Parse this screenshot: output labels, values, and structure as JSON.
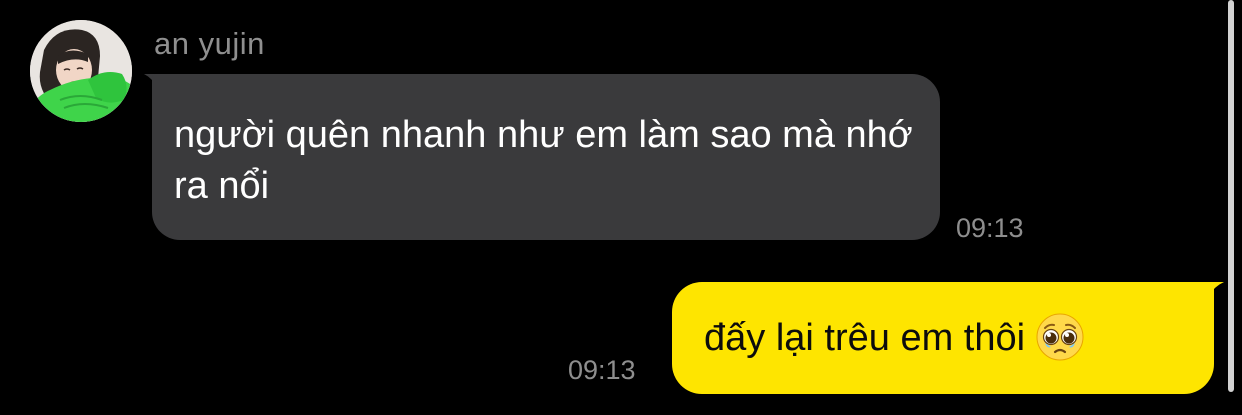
{
  "conversation": {
    "incoming": {
      "sender_name": "an yujin",
      "avatar_icon": "user-avatar-photo",
      "text": "người quên nhanh như em làm sao mà nhớ ra nổi",
      "time": "09:13",
      "bubble_color": "#3a3a3c"
    },
    "outgoing": {
      "text": "đấy lại trêu em thôi",
      "emoji_icon": "pleading-face-emoji",
      "time": "09:13",
      "bubble_color": "#fee500"
    }
  },
  "theme": {
    "background": "#000000",
    "timestamp_color": "#8e8e8e"
  }
}
